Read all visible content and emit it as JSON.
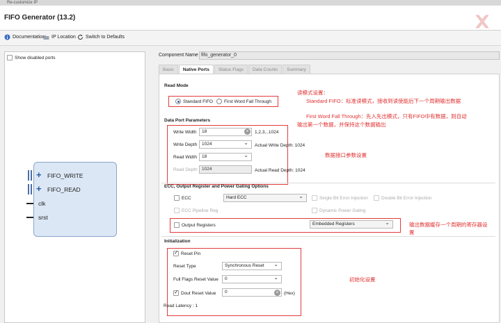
{
  "window": {
    "title": "Re-customize IP"
  },
  "header": {
    "title": "FIFO Generator (13.2)"
  },
  "toolbar": {
    "documentation": "Documentation",
    "ip_location": "IP Location",
    "switch_defaults": "Switch to Defaults"
  },
  "left": {
    "show_disabled": "Show disabled ports",
    "ports": {
      "fifo_write": "FIFO_WRITE",
      "fifo_read": "FIFO_READ",
      "clk": "clk",
      "srst": "srst"
    }
  },
  "component": {
    "label": "Component Name",
    "value": "fifo_generator_0"
  },
  "tabs": [
    "Basic",
    "Native Ports",
    "Status Flags",
    "Data Counts",
    "Summary"
  ],
  "read_mode": {
    "title": "Read Mode",
    "standard": "Standard FIFO",
    "fwft": "First Word Fall Through"
  },
  "data_port": {
    "title": "Data Port Parameters",
    "write_width_label": "Write Width",
    "write_width": "18",
    "write_width_hint": "1,2,3,..1024",
    "write_depth_label": "Write Depth",
    "write_depth": "1024",
    "actual_write_depth": "Actual Write Depth: 1024",
    "read_width_label": "Read Width",
    "read_width": "18",
    "read_depth_label": "Read Depth",
    "read_depth": "1024",
    "actual_read_depth": "Actual Read Depth: 1024"
  },
  "ecc": {
    "title": "ECC, Output Register and Power Gating Options",
    "ecc_label": "ECC",
    "ecc_value": "Hard ECC",
    "single_bit": "Single Bit Error Injection",
    "double_bit": "Double Bit Error Injection",
    "pipeline": "ECC Pipeline Reg",
    "dynamic_power": "Dynamic Power Gating",
    "output_registers": "Output Registers",
    "output_reg_value": "Embedded Registers"
  },
  "init": {
    "title": "Initialization",
    "reset_pin": "Reset Pin",
    "reset_type_label": "Reset Type",
    "reset_type": "Synchronous Reset",
    "full_flags_label": "Full Flags Reset Value",
    "full_flags": "0",
    "dout_label": "Dout Reset Value",
    "dout_value": "0",
    "hex": "(Hex)",
    "read_latency": "Read Latency : 1"
  },
  "notes": {
    "read_mode_1": "读模式设置：",
    "read_mode_2": "Standard FIFO：标准读模式，接收到读使能后下一个周期输出数据",
    "read_mode_3": "First Word Fall Through：先入先出模式，只有FIFO中有数据，则自动",
    "read_mode_4": "输出第一个数据，并保持这个数据输出",
    "data_port": "数据接口参数设置",
    "output_reg_1": "输出数据缓存一个周期的寄存器设",
    "output_reg_2": "置",
    "init": "初始化设置"
  },
  "colors": {
    "annotation": "#e23a3a",
    "block_fill": "#dbe7f5",
    "radio_dot": "#2b59a6"
  }
}
